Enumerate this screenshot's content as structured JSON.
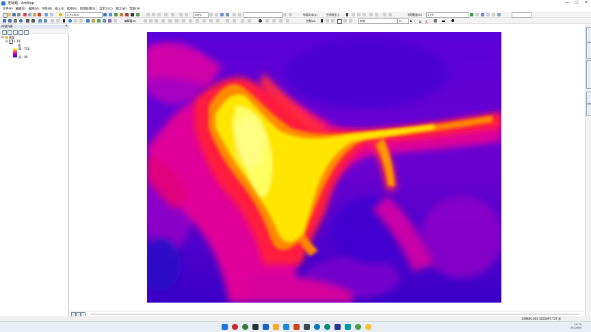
{
  "window": {
    "title": "无标题 - ArcMap",
    "controls": [
      "—",
      "▢",
      "✕"
    ]
  },
  "menu": [
    "文件(F)",
    "编辑(E)",
    "视图(V)",
    "书签(B)",
    "插入(I)",
    "选择(S)",
    "地理处理(G)",
    "自定义(C)",
    "窗口(W)",
    "帮助(H)"
  ],
  "toolbar": {
    "scale_value": "1: 95,800",
    "zoom_percent": "100%",
    "layout_text_label": "布局文本(A)",
    "space_adjust_label": "空间校正(J)",
    "georeference_label": "地理配准(G)",
    "georef_layer_value": "1.TIF",
    "editor_label": "编辑器(R)",
    "draw_label": "绘制(D)",
    "font_name": "宋体",
    "font_size": "10",
    "bold": "B",
    "italic": "I",
    "underline": "U",
    "font_color_letter": "A"
  },
  "toc": {
    "title": "内容列表",
    "close": "✕",
    "root_layer": "图层",
    "layer_name": "1.TIF",
    "field_label": "值",
    "high_label": "高 : 750",
    "low_label": "低 : 90"
  },
  "status": {
    "coordinates": "549860.003  3255697.737 米"
  },
  "clock": {
    "time": "14:14",
    "date": "2022/8/4"
  },
  "colors": {
    "ramp_high": "#ffff00",
    "ramp_mid": "#ff00aa",
    "ramp_low": "#1a00c8",
    "accent": "#2b7bd4"
  }
}
